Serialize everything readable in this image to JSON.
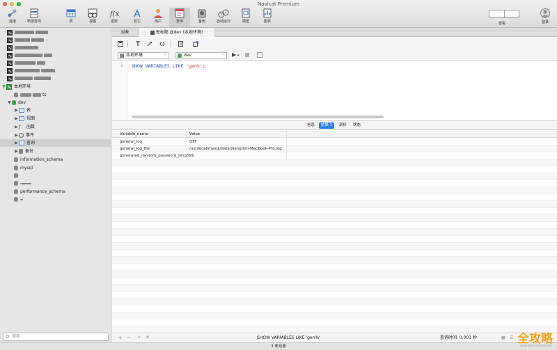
{
  "window": {
    "title": "Navicat Premium"
  },
  "toolbar": {
    "items": [
      {
        "label": "连接",
        "icon": "connection-icon"
      },
      {
        "label": "新建查询",
        "icon": "new-query-icon"
      },
      {
        "label": "表",
        "icon": "table-icon"
      },
      {
        "label": "视图",
        "icon": "view-icon"
      },
      {
        "label": "函数",
        "icon": "function-icon"
      },
      {
        "label": "其它",
        "icon": "other-icon"
      },
      {
        "label": "用户",
        "icon": "user-icon"
      },
      {
        "label": "查询",
        "icon": "query-icon"
      },
      {
        "label": "备份",
        "icon": "backup-icon"
      },
      {
        "label": "自动运行",
        "icon": "automation-icon"
      },
      {
        "label": "模型",
        "icon": "model-icon"
      },
      {
        "label": "图表",
        "icon": "chart-icon"
      }
    ],
    "view_label": "查看",
    "signin_label": "登录"
  },
  "sidebar": {
    "local_connection": "本地环境",
    "local_sub": "ts",
    "database": "dev",
    "db_children": [
      "表",
      "视图",
      "函数",
      "事件",
      "查询",
      "备份"
    ],
    "other_dbs": [
      "information_schema",
      "mysql",
      "performance_schema"
    ],
    "search_placeholder": "搜索"
  },
  "tabs": {
    "objects": "对象",
    "query_tab": "无标题 @dev (本地环境)"
  },
  "selectors": {
    "connection": "本地环境",
    "database": "dev"
  },
  "editor": {
    "line": "1",
    "kw": "SHOW VARIABLES LIKE",
    "str": "'gen%'",
    "end": ";"
  },
  "result_tabs": {
    "info": "信息",
    "result1": "结果 1",
    "profile": "剖析",
    "status": "状态"
  },
  "grid": {
    "headers": [
      "Variable_name",
      "Value"
    ],
    "rows": [
      [
        "general_log",
        "OFF"
      ],
      [
        "general_log_file",
        "/usr/local/mysql/data/xiangmin-MacBook-Pro.log"
      ],
      [
        "generated_random_password_length",
        "20"
      ]
    ]
  },
  "footer": {
    "query": "SHOW VARIABLES LIKE 'gen%'",
    "time": "查询时间: 0.001 秒"
  },
  "status": {
    "records": "3 条记录"
  },
  "watermark": {
    "text": "全攻略",
    "sub": "www.wintrust-tech.net"
  },
  "colors": {
    "accent": "#2d7ee6",
    "keyword": "#1f47b8",
    "string": "#c0392b"
  }
}
